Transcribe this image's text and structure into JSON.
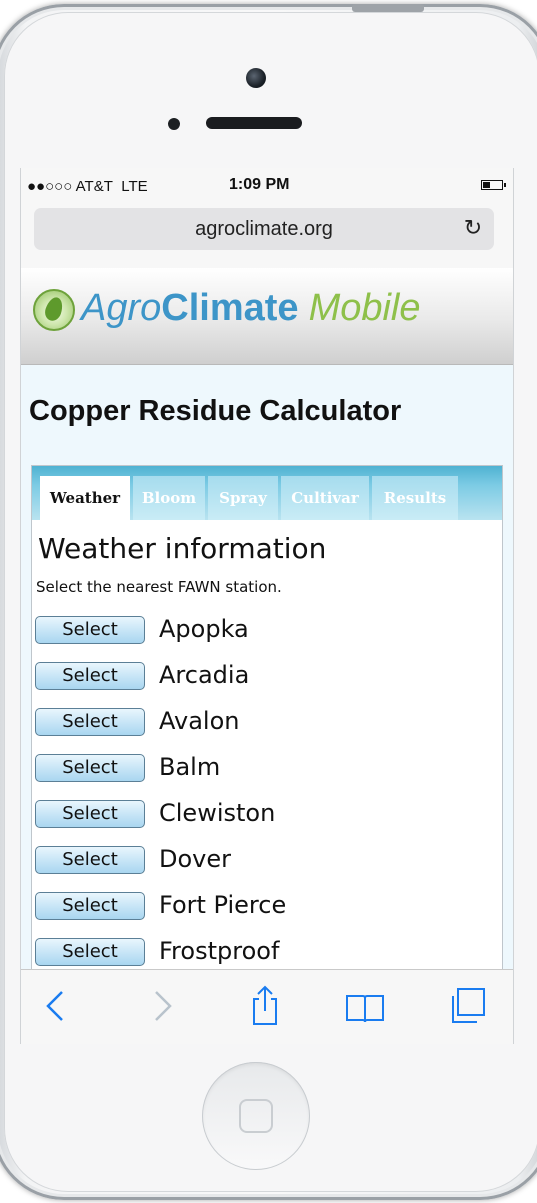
{
  "status_bar": {
    "carrier": "●●○○○ AT&T",
    "network": "LTE",
    "time": "1:09 PM"
  },
  "browser": {
    "url": "agroclimate.org",
    "reload_icon": "reload-icon"
  },
  "brand": {
    "logo_part1": "Agro",
    "logo_part2": "Climate",
    "logo_part3": "Mobile",
    "colors": {
      "blue": "#3d95c8",
      "green": "#8ec04a"
    }
  },
  "page": {
    "title": "Copper Residue Calculator"
  },
  "tabs": [
    {
      "label": "Weather",
      "active": true
    },
    {
      "label": "Bloom",
      "active": false
    },
    {
      "label": "Spray",
      "active": false
    },
    {
      "label": "Cultivar",
      "active": false
    },
    {
      "label": "Results",
      "active": false
    }
  ],
  "weather": {
    "heading": "Weather information",
    "instruction": "Select the nearest FAWN station.",
    "select_label": "Select",
    "stations": [
      "Apopka",
      "Arcadia",
      "Avalon",
      "Balm",
      "Clewiston",
      "Dover",
      "Fort Pierce",
      "Frostproof"
    ]
  },
  "toolbar": {
    "icons": [
      "back-icon",
      "forward-icon",
      "share-icon",
      "bookmarks-icon",
      "tabs-icon"
    ],
    "accent": "#1a7cf0"
  }
}
